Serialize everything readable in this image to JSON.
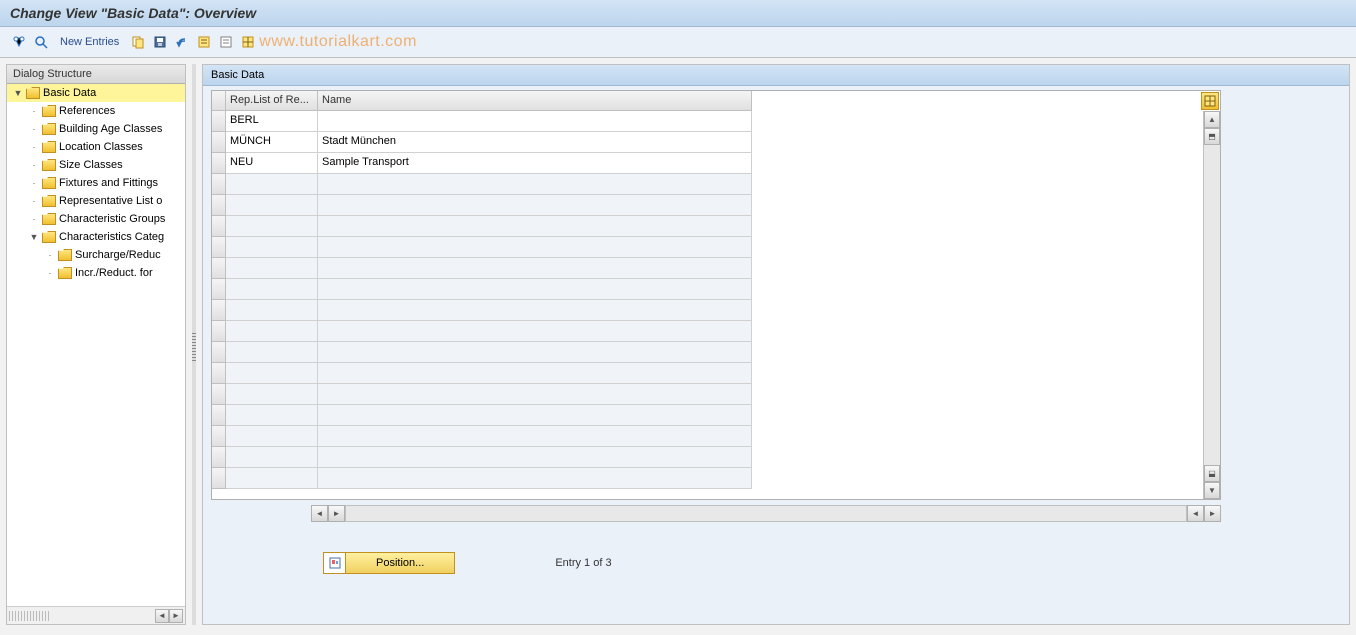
{
  "title": "Change View \"Basic Data\": Overview",
  "toolbar": {
    "new_entries_label": "New Entries"
  },
  "watermark": "www.tutorialkart.com",
  "sidebar": {
    "header": "Dialog Structure",
    "items": [
      {
        "label": "Basic Data",
        "level": 0,
        "selected": true,
        "expanded": true,
        "toggle": "▼"
      },
      {
        "label": "References",
        "level": 1,
        "leaf": true,
        "toggle": "·"
      },
      {
        "label": "Building Age Classes",
        "level": 1,
        "leaf": true,
        "toggle": "·"
      },
      {
        "label": "Location Classes",
        "level": 1,
        "leaf": true,
        "toggle": "·"
      },
      {
        "label": "Size Classes",
        "level": 1,
        "leaf": true,
        "toggle": "·"
      },
      {
        "label": "Fixtures and Fittings",
        "level": 1,
        "leaf": true,
        "toggle": "·"
      },
      {
        "label": "Representative List o",
        "level": 1,
        "leaf": true,
        "toggle": "·"
      },
      {
        "label": "Characteristic Groups",
        "level": 1,
        "leaf": true,
        "toggle": "·"
      },
      {
        "label": "Characteristics Categ",
        "level": 1,
        "expanded": true,
        "toggle": "▼"
      },
      {
        "label": "Surcharge/Reduc",
        "level": 2,
        "leaf": true,
        "toggle": "·"
      },
      {
        "label": "Incr./Reduct. for",
        "level": 2,
        "leaf": true,
        "toggle": "·"
      }
    ]
  },
  "panel": {
    "title": "Basic Data",
    "columns": [
      "Rep.List of Re...",
      "Name"
    ],
    "rows": [
      {
        "code": "BERL",
        "name": ""
      },
      {
        "code": "MÜNCH",
        "name": "Stadt München"
      },
      {
        "code": "NEU",
        "name": "Sample Transport"
      }
    ],
    "empty_rows": 15
  },
  "footer": {
    "position_label": "Position...",
    "entry_status": "Entry 1 of 3"
  }
}
